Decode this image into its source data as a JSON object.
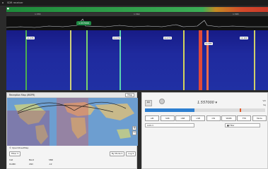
{
  "window": {
    "title": "SDR receiver"
  },
  "colorbar_label": "■",
  "marker": {
    "frequency": "1.557000"
  },
  "waterfall_labels": [
    "14.035",
    "14.070",
    "14.074",
    "14.085",
    "14.200"
  ],
  "scale_ticks": [
    "1.555",
    "1.560",
    "1.565"
  ],
  "map_panel": {
    "title": "Reception Map (WSPR)",
    "menu_label": "Map",
    "footer": "© OpenStreetMap",
    "filter_label": "Filter ▾",
    "mode_label": "By Mode ▾",
    "log_label": "Log ▾",
    "table_headers": [
      "Call",
      "Band",
      "SNR"
    ],
    "table_rows": [
      [
        "K1ABC",
        "20m",
        "-12"
      ]
    ]
  },
  "control_panel": {
    "frequency": "1.557000 ▾",
    "led_label": "RX",
    "buttons": [
      "AM",
      "SSB",
      "USB",
      "LSB",
      "CW",
      "WSPR",
      "FT8",
      "Mode"
    ],
    "select_mode": "Auto ▾",
    "select_filter": "■ Filter",
    "side_top": "Vol",
    "side_bottom": "Sq"
  },
  "colors": {
    "accent": "#2d7fd1",
    "waterfall": "#1f2a9e",
    "marker": "#1e8a44"
  }
}
